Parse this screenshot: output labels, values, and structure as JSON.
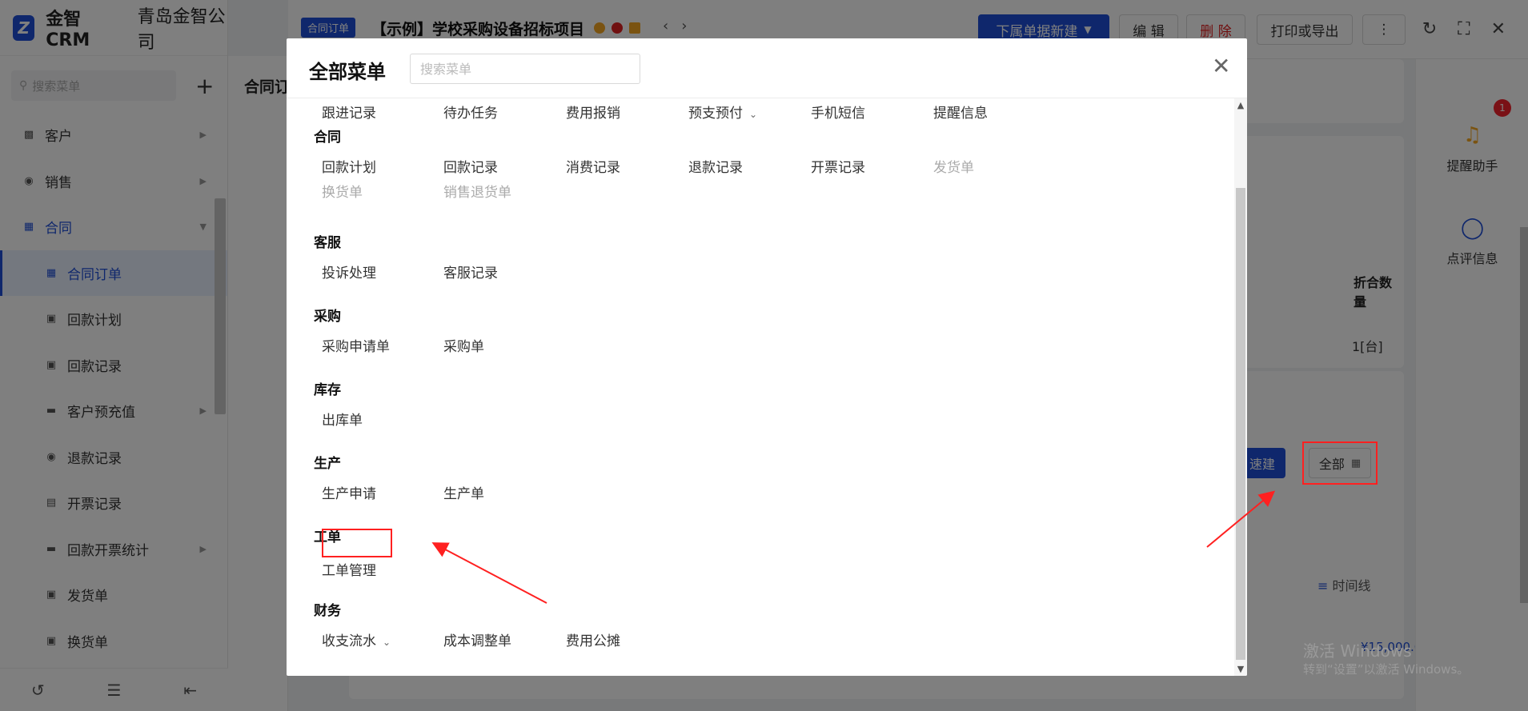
{
  "app": {
    "brand_name": "金智CRM",
    "company": "青岛金智公司",
    "search_placeholder": "搜索菜单"
  },
  "sidebar": {
    "items": [
      {
        "label": "客户",
        "icon": "customer-icon",
        "level": 0,
        "arrow": true
      },
      {
        "label": "销售",
        "icon": "sales-icon",
        "level": 0,
        "arrow": true
      },
      {
        "label": "合同",
        "icon": "contract-icon",
        "level": 0,
        "arrow": true,
        "open": true
      },
      {
        "label": "合同订单",
        "icon": "contract-order-icon",
        "level": 1,
        "active": true
      },
      {
        "label": "回款计划",
        "icon": "payment-plan-icon",
        "level": 1
      },
      {
        "label": "回款记录",
        "icon": "payment-record-icon",
        "level": 1
      },
      {
        "label": "客户预充值",
        "icon": "folder-icon",
        "level": 1,
        "arrow": true
      },
      {
        "label": "退款记录",
        "icon": "refund-icon",
        "level": 1
      },
      {
        "label": "开票记录",
        "icon": "invoice-icon",
        "level": 1
      },
      {
        "label": "回款开票统计",
        "icon": "folder-icon",
        "level": 1,
        "arrow": true
      },
      {
        "label": "发货单",
        "icon": "delivery-icon",
        "level": 1
      },
      {
        "label": "换货单",
        "icon": "exchange-icon",
        "level": 1
      }
    ]
  },
  "list_panel": {
    "title": "合同订"
  },
  "detail": {
    "tag": "合同订单",
    "title": "【示例】学校采购设备招标项目",
    "buttons": {
      "new_sub": "下属单据新建",
      "edit": "编 辑",
      "delete": "删 除",
      "print": "打印或导出",
      "more": "⋮"
    },
    "table_header": "折合数量",
    "table_cell": "1[台]",
    "amount": "¥15,000.00",
    "quick_label": "速建",
    "all_label": "全部",
    "timeline_label": "时间线"
  },
  "right_rail": {
    "reminder_label": "提醒助手",
    "reminder_badge": "1",
    "review_label": "点评信息"
  },
  "watermark": {
    "line1": "激活 Windows",
    "line2": "转到“设置”以激活 Windows。"
  },
  "modal": {
    "title": "全部菜单",
    "search_placeholder": "搜索菜单",
    "top_row": [
      {
        "label": "跟进记录"
      },
      {
        "label": "待办任务"
      },
      {
        "label": "费用报销"
      },
      {
        "label": "预支预付",
        "chevron": true
      },
      {
        "label": "手机短信"
      },
      {
        "label": "提醒信息"
      }
    ],
    "groups": [
      {
        "title": "合同",
        "rows": [
          [
            {
              "label": "回款计划"
            },
            {
              "label": "回款记录"
            },
            {
              "label": "消费记录"
            },
            {
              "label": "退款记录"
            },
            {
              "label": "开票记录"
            },
            {
              "label": "发货单",
              "disabled": true
            }
          ],
          [
            {
              "label": "换货单",
              "disabled": true
            },
            {
              "label": "销售退货单",
              "disabled": true
            }
          ]
        ]
      },
      {
        "title": "客服",
        "rows": [
          [
            {
              "label": "投诉处理"
            },
            {
              "label": "客服记录"
            }
          ]
        ]
      },
      {
        "title": "采购",
        "rows": [
          [
            {
              "label": "采购申请单"
            },
            {
              "label": "采购单"
            }
          ]
        ]
      },
      {
        "title": "库存",
        "rows": [
          [
            {
              "label": "出库单"
            }
          ]
        ]
      },
      {
        "title": "生产",
        "rows": [
          [
            {
              "label": "生产申请"
            },
            {
              "label": "生产单"
            }
          ]
        ]
      },
      {
        "title": "工单",
        "rows": [
          [
            {
              "label": "工单管理"
            }
          ]
        ]
      },
      {
        "title": "财务",
        "rows": [
          [
            {
              "label": "收支流水",
              "chevron": true
            },
            {
              "label": "成本调整单"
            },
            {
              "label": "费用公摊"
            }
          ]
        ]
      }
    ]
  },
  "colors": {
    "accent": "#1f4fd8",
    "danger": "#e02020",
    "annotation": "#ff2020"
  }
}
